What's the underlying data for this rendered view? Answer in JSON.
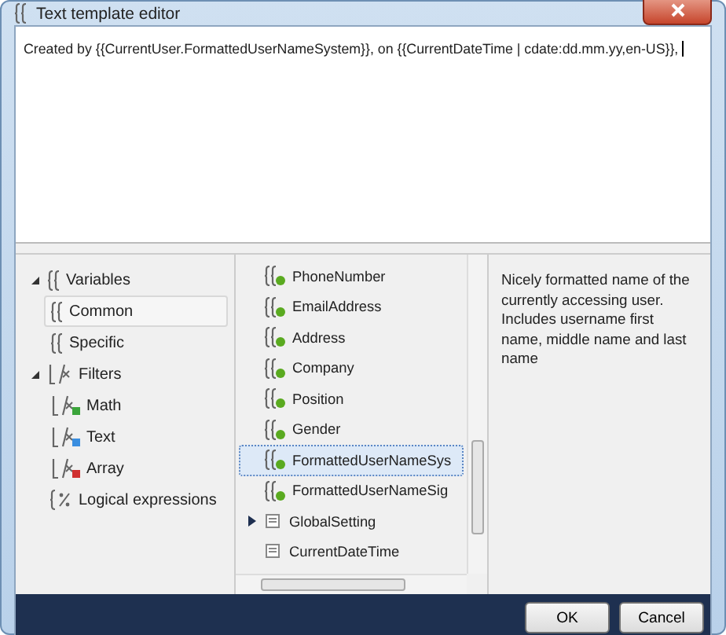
{
  "window": {
    "title": "Text template editor"
  },
  "editor": {
    "value": "Created by {{CurrentUser.FormattedUserNameSystem}}, on {{CurrentDateTime | cdate:dd.mm.yy,en-US}},"
  },
  "categories": [
    {
      "label": "Variables",
      "kind": "variables",
      "expanded": true,
      "selected": false,
      "children": [
        {
          "label": "Common",
          "kind": "variables",
          "selected": true
        },
        {
          "label": "Specific",
          "kind": "variables",
          "selected": false
        }
      ]
    },
    {
      "label": "Filters",
      "kind": "filters",
      "expanded": true,
      "selected": false,
      "children": [
        {
          "label": "Math",
          "kind": "filter",
          "color": "#3aa43a",
          "selected": false
        },
        {
          "label": "Text",
          "kind": "filter",
          "color": "#3a8ee0",
          "selected": false
        },
        {
          "label": "Array",
          "kind": "filter",
          "color": "#d03030",
          "selected": false
        }
      ]
    },
    {
      "label": "Logical expressions",
      "kind": "logic",
      "selected": false
    }
  ],
  "members": [
    {
      "label": "PhoneNumber",
      "kind": "variable",
      "selected": false
    },
    {
      "label": "EmailAddress",
      "kind": "variable",
      "selected": false
    },
    {
      "label": "Address",
      "kind": "variable",
      "selected": false
    },
    {
      "label": "Company",
      "kind": "variable",
      "selected": false
    },
    {
      "label": "Position",
      "kind": "variable",
      "selected": false
    },
    {
      "label": "Gender",
      "kind": "variable",
      "selected": false
    },
    {
      "label": "FormattedUserNameSys",
      "kind": "variable",
      "selected": true
    },
    {
      "label": "FormattedUserNameSig",
      "kind": "variable",
      "selected": false
    },
    {
      "label": "GlobalSetting",
      "kind": "object",
      "expanded": false,
      "selected": false
    },
    {
      "label": "CurrentDateTime",
      "kind": "object",
      "selected": false
    }
  ],
  "description": "Nicely formatted name of the currently accessing user. Includes username first name, middle name and last name",
  "buttons": [
    {
      "label": "OK"
    },
    {
      "label": "Cancel"
    }
  ]
}
